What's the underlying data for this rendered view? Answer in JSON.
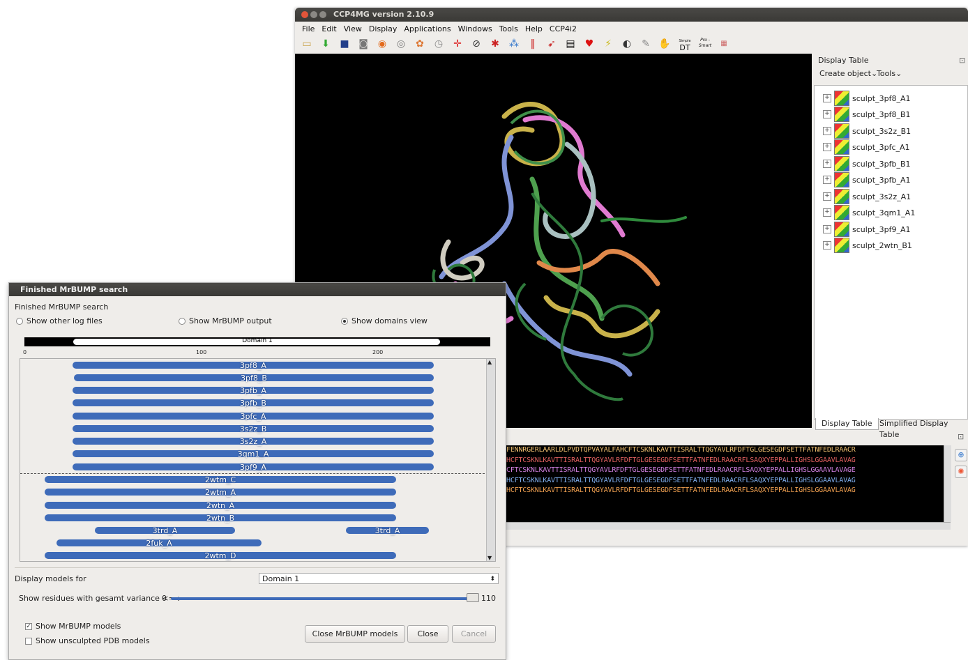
{
  "main_window": {
    "title": "CCP4MG version 2.10.9",
    "menu": [
      "File",
      "Edit",
      "View",
      "Display",
      "Applications",
      "Windows",
      "Tools",
      "Help",
      "CCP4i2"
    ],
    "toolbar_icons": [
      "open-folder-icon",
      "download-icon",
      "save-icon",
      "camera-icon",
      "eye-icon",
      "eye-outline-icon",
      "color-wheel-icon",
      "clock-icon",
      "crosshair-icon",
      "magnify-icon",
      "star-burst-icon",
      "molecule-icon",
      "ruler-icon",
      "bird-icon",
      "clapperboard-icon",
      "heart-icon",
      "wand-icon",
      "vr-eye-icon",
      "pen-icon",
      "hand-icon",
      "dt-text-icon",
      "pro-smart-icon",
      "color-grid-icon"
    ],
    "toolbar_text": {
      "dt": "DT",
      "simple": "Simple",
      "pro": "Pro -",
      "smart": "Smart"
    }
  },
  "display_table": {
    "title": "Display Table",
    "create_object": "Create object",
    "tools": "Tools",
    "items": [
      "sculpt_3pf8_A1",
      "sculpt_3pf8_B1",
      "sculpt_3s2z_B1",
      "sculpt_3pfc_A1",
      "sculpt_3pfb_B1",
      "sculpt_3pfb_A1",
      "sculpt_3s2z_A1",
      "sculpt_3qm1_A1",
      "sculpt_3pf9_A1",
      "sculpt_2wtn_B1"
    ],
    "tabs": [
      "Display Table",
      "Simplified Display Table"
    ]
  },
  "sequence": {
    "lines": [
      "FENNRGERLAARLDLPVDTQPVAYALFAHCFTCSKNLKAVTTISRALTTQGYAVLRFDFTGLGESEGDFSETTFATNFEDLRAACR",
      "HCFTCSKNLKAVTTISRALTTQGYAVLRFDFTGLGESEGDFSETTFATNFEDLRAACRFLSAQXYEPPALLIGHSLGGAAVLAVAG",
      "CFTCSKNLKAVTTISRALTTQGYAVLRFDFTGLGESEGDFSETTFATNFEDLRAACRFLSAQXYEPPALLIGHSLGGAAVLAVAGE",
      "HCFTCSKNLKAVTTISRALTTQGYAVLRFDFTGLGESEGDFSETTFATNFEDLRAACRFLSAQXYEPPALLIGHSLGGAAVLAVAG",
      "HCFTCSKNLKAVTTISRALTTQGYAVLRFDFTGLGESEGDFSETTFATNFEDLRAACRFLSAQXYEPPALLIGHSLGGAAVLAVAG"
    ]
  },
  "dialog": {
    "title": "Finished MrBUMP search",
    "heading": "Finished MrBUMP search",
    "radios": [
      {
        "label": "Show other log files",
        "checked": false
      },
      {
        "label": "Show MrBUMP output",
        "checked": false
      },
      {
        "label": "Show domains view",
        "checked": true
      }
    ],
    "ruler": {
      "domain_label": "Domain 1",
      "ticks": [
        "0",
        "100",
        "200"
      ]
    },
    "domain_bars": [
      {
        "label": "3pf8_A"
      },
      {
        "label": "3pf8_B"
      },
      {
        "label": "3pfb_A"
      },
      {
        "label": "3pfb_B"
      },
      {
        "label": "3pfc_A"
      },
      {
        "label": "3s2z_B"
      },
      {
        "label": "3s2z_A"
      },
      {
        "label": "3qm1_A"
      },
      {
        "label": "3pf9_A"
      },
      {
        "label": "2wtm_C"
      },
      {
        "label": "2wtm_A"
      },
      {
        "label": "2wtn_A"
      },
      {
        "label": "2wtn_B"
      },
      {
        "label": "3trd_A"
      },
      {
        "label": "3trd_A"
      },
      {
        "label": "2fuk_A"
      },
      {
        "label": "2wtm_D"
      }
    ],
    "display_models_for_label": "Display models for",
    "display_models_for_value": "Domain 1",
    "variance_label": "Show residues with gesamt variance <= :",
    "variance_min": "0",
    "variance_max": "110",
    "show_mrbump_models": {
      "label": "Show MrBUMP models",
      "checked": true
    },
    "show_unsculpted": {
      "label": "Show unsculpted PDB models",
      "checked": false
    },
    "buttons": {
      "close_models": "Close MrBUMP models",
      "close": "Close",
      "cancel": "Cancel"
    }
  }
}
